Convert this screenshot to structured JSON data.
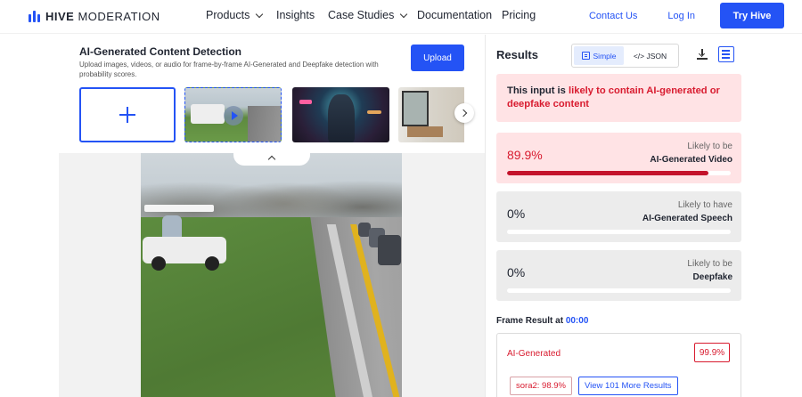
{
  "nav": {
    "logo_bold": "HIVE",
    "logo_rest": "MODERATION",
    "links": [
      {
        "label": "Products",
        "has_menu": true
      },
      {
        "label": "Insights",
        "has_menu": false
      },
      {
        "label": "Case Studies",
        "has_menu": true
      },
      {
        "label": "Documentation",
        "has_menu": false
      },
      {
        "label": "Pricing",
        "has_menu": false
      }
    ],
    "contact": "Contact Us",
    "login": "Log In",
    "try": "Try Hive"
  },
  "detector": {
    "title": "AI-Generated Content Detection",
    "description": "Upload images, videos, or audio for frame-by-frame AI-Generated and Deepfake detection with probability scores.",
    "upload": "Upload"
  },
  "results": {
    "title": "Results",
    "toggle_simple": "Simple",
    "toggle_json": "</> JSON",
    "alert_prefix": "This input is ",
    "alert_highlight": "likely to contain AI-generated or deepfake content",
    "cards": [
      {
        "pct": "89.9%",
        "prefix": "Likely to be",
        "label": "AI-Generated Video",
        "value": 0.899,
        "style": "red"
      },
      {
        "pct": "0%",
        "prefix": "Likely to have",
        "label": "AI-Generated Speech",
        "value": 0,
        "style": "grey"
      },
      {
        "pct": "0%",
        "prefix": "Likely to be",
        "label": "Deepfake",
        "value": 0,
        "style": "grey"
      }
    ],
    "frame_result_label": "Frame Result at",
    "frame_time": "00:00",
    "frame": {
      "class": "AI-Generated",
      "pct": "99.9%",
      "tag": "sora2: 98.9%",
      "more": "View 101 More Results"
    }
  },
  "colors": {
    "accent": "#2453f5",
    "danger": "#d81b2f",
    "danger_bg": "#ffe3e5"
  }
}
